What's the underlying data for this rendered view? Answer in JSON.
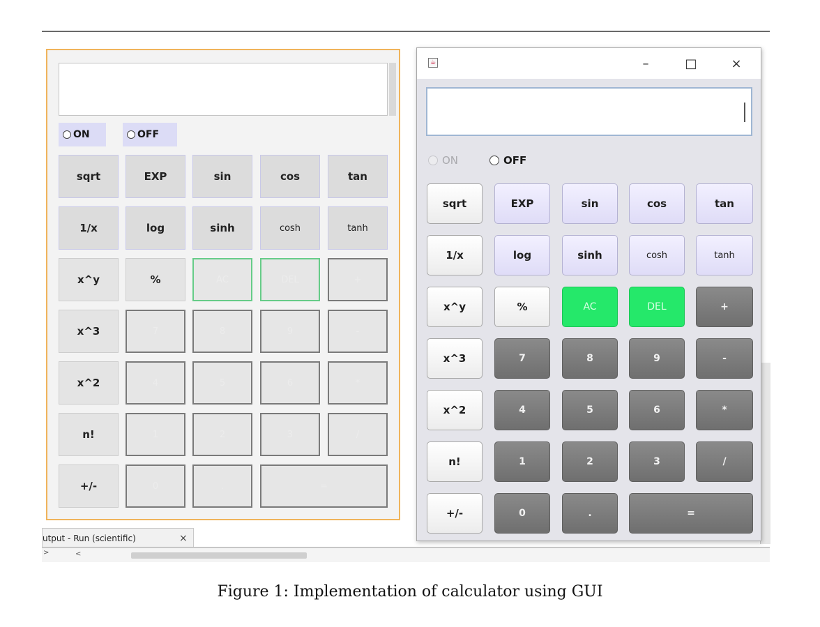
{
  "ide": {
    "output_tab_label": "utput - Run (scientific)",
    "output_tab_close": "×",
    "output_gutter": ">",
    "output_caret": "<"
  },
  "design": {
    "radio_on": "ON",
    "radio_off": "OFF",
    "buttons": [
      "sqrt",
      "EXP",
      "sin",
      "cos",
      "tan",
      "1/x",
      "log",
      "sinh",
      "cosh",
      "tanh",
      "x^y",
      "%",
      "AC",
      "DEL",
      "+",
      "x^3",
      "7",
      "8",
      "9",
      "-",
      "x^2",
      "4",
      "5",
      "6",
      "*",
      "n!",
      "1",
      "2",
      "3",
      "/",
      "+/-",
      "0",
      ".",
      "="
    ]
  },
  "window": {
    "minimize": "–",
    "maximize": "□",
    "close": "×",
    "display_value": "",
    "radio_on": "ON",
    "radio_off": "OFF",
    "radio_on_enabled": false,
    "buttons": [
      "sqrt",
      "EXP",
      "sin",
      "cos",
      "tan",
      "1/x",
      "log",
      "sinh",
      "cosh",
      "tanh",
      "x^y",
      "%",
      "AC",
      "DEL",
      "+",
      "x^3",
      "7",
      "8",
      "9",
      "-",
      "x^2",
      "4",
      "5",
      "6",
      "*",
      "n!",
      "1",
      "2",
      "3",
      "/",
      "+/-",
      "0",
      ".",
      "="
    ]
  },
  "colors": {
    "accent_green": "#25e86a",
    "digit_gray": "#7a7a7a",
    "function_lavender": "#dfdcf7",
    "design_border": "#f0b45b"
  },
  "caption": "Figure 1: Implementation of calculator using GUI"
}
